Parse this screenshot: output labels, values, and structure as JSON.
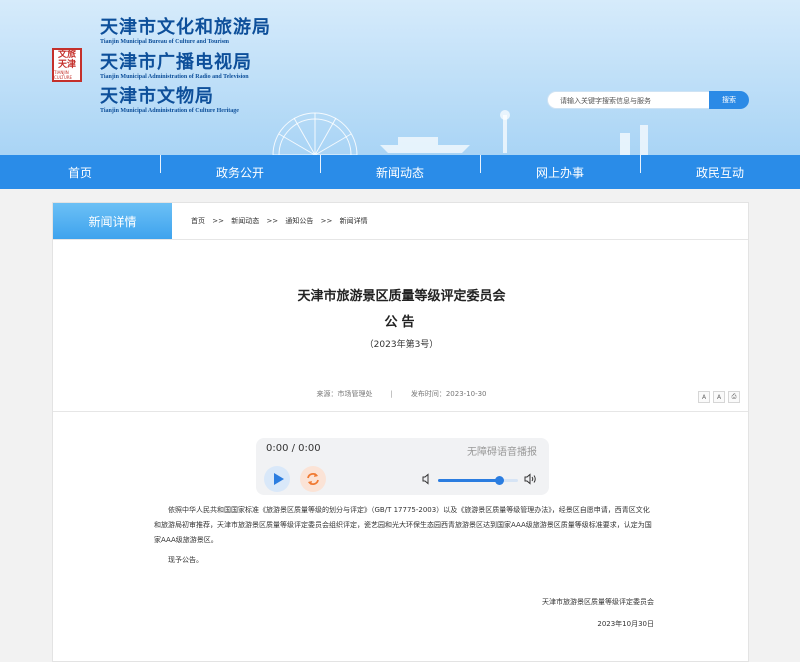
{
  "header": {
    "logo": {
      "chars_top": "文旅",
      "chars_bottom": "天津",
      "caption": "TIANJIN CULTURE"
    },
    "orgs": [
      {
        "cn": "天津市文化和旅游局",
        "en": "Tianjin Municipal Bureau of Culture and Tourism"
      },
      {
        "cn": "天津市广播电视局",
        "en": "Tianjin Municipal Administration of Radio and Television"
      },
      {
        "cn": "天津市文物局",
        "en": "Tianjin Municipal Administration of Culture Heritage"
      }
    ],
    "search": {
      "placeholder": "请输入关键字搜索信息与服务",
      "button": "搜索"
    }
  },
  "nav": [
    "首页",
    "政务公开",
    "新闻动态",
    "网上办事",
    "政民互动"
  ],
  "detail": {
    "tab": "新闻详情",
    "breadcrumb": [
      "首页",
      ">>",
      "新闻动态",
      ">>",
      "通知公告",
      ">>",
      "新闻详情"
    ],
    "title_1": "天津市旅游景区质量等级评定委员会",
    "title_2": "公告",
    "issue": "（2023年第3号）",
    "source": "来源：市场管理处",
    "separator": "|",
    "published": "发布时间：2023-10-30",
    "font_controls": [
      "A",
      "A",
      "⎙"
    ]
  },
  "player": {
    "time": "0:00 / 0:00",
    "label": "无障碍语音播报",
    "volume_fraction": 0.75
  },
  "body": {
    "paragraph_1": "依照中华人民共和国国家标准《旅游景区质量等级的划分与评定》（GB/T 17775-2003）以及《旅游景区质量等级管理办法》，经景区自愿申请，西青区文化和旅游局初审推荐，天津市旅游景区质量等级评定委员会组织评定，瓷艺园和光大环保生态园西青旅游景区达到国家AAA级旅游景区质量等级标准要求，认定为国家AAA级旅游景区。",
    "paragraph_2": "现予公告。",
    "signature": "天津市旅游景区质量等级评定委员会",
    "date": "2023年10月30日"
  },
  "colors": {
    "nav": "#2a8ce8",
    "accent": "#2b7de0",
    "title_blue": "#0d4f9a"
  }
}
